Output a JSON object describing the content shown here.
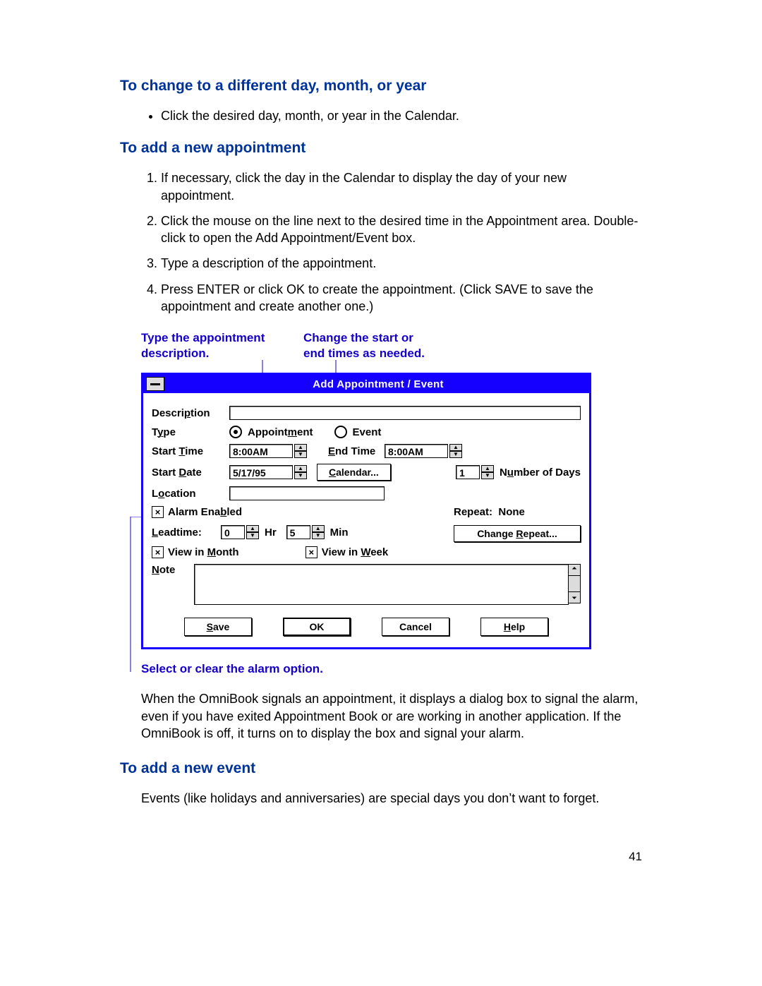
{
  "heading1": "To change to a different day, month, or year",
  "bullet1": "Click the desired day, month, or year in the Calendar.",
  "heading2": "To add a new appointment",
  "steps": [
    "If necessary, click the day in the Calendar to display the day of your new appointment.",
    "Click the mouse on the line next to the desired time in the Appointment area. Double-click to open the Add Appointment/Event box.",
    "Type a description of the appointment.",
    "Press ENTER or click OK to create the appointment. (Click SAVE to save the appointment and create another one.)"
  ],
  "callout_left_l1": "Type the appointment",
  "callout_left_l2": "description.",
  "callout_right_l1": "Change the start or",
  "callout_right_l2": "end times as needed.",
  "callout_bottom": "Select or clear the alarm option.",
  "dialog": {
    "title": "Add Appointment / Event",
    "labels": {
      "description": "Description",
      "type": "Type",
      "start_time": "Start Time",
      "end_time": "End Time",
      "start_date": "Start Date",
      "number_of_days": "Number of Days",
      "location": "Location",
      "alarm_enabled": "Alarm Enabled",
      "leadtime": "Leadtime:",
      "hr": "Hr",
      "min": "Min",
      "view_in_month": "View in Month",
      "view_in_week": "View in Week",
      "note": "Note",
      "repeat": "Repeat:",
      "repeat_value": "None"
    },
    "values": {
      "description": "",
      "radio_appointment": "Appointment",
      "radio_event": "Event",
      "start_time": "8:00AM",
      "end_time": "8:00AM",
      "start_date": "5/17/95",
      "number_of_days": "1",
      "location": "",
      "leadtime_hr": "0",
      "leadtime_min": "5",
      "note": ""
    },
    "checkboxes": {
      "alarm_enabled": true,
      "view_in_month": true,
      "view_in_week": true
    },
    "radios": {
      "type_selected": "appointment"
    },
    "buttons": {
      "calendar": "Calendar...",
      "change_repeat": "Change Repeat...",
      "save": "Save",
      "ok": "OK",
      "cancel": "Cancel",
      "help": "Help"
    }
  },
  "para_after": "When the OmniBook signals an appointment, it displays a dialog box to signal the alarm, even if you have exited Appointment Book or are working in another application. If the OmniBook is off, it turns on to display the box and signal your alarm.",
  "heading3": "To add a new event",
  "para_events": "Events (like holidays and anniversaries) are special days you don’t want to forget.",
  "page_number": "41"
}
